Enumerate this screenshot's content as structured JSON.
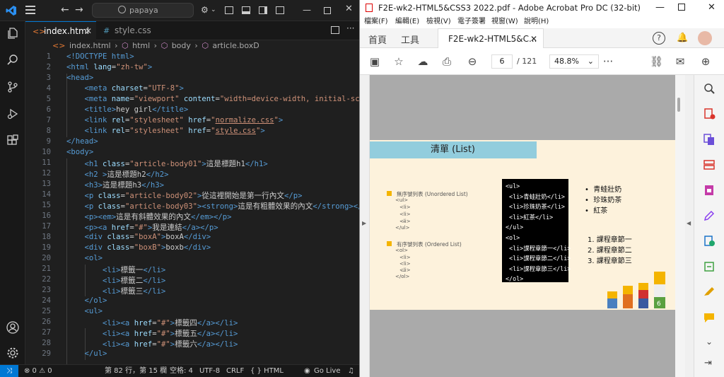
{
  "vscode": {
    "command_center": "papaya",
    "tabs": [
      {
        "label": "index.html",
        "icon": "<>"
      },
      {
        "label": "style.css",
        "icon": "#"
      }
    ],
    "breadcrumb": [
      "index.html",
      "html",
      "body",
      "article.boxD"
    ],
    "code_lines": [
      {
        "n": "1",
        "html": "<span class='t'>&lt;!DOCTYPE html&gt;</span>"
      },
      {
        "n": "2",
        "html": "<span class='t'>&lt;html</span> <span class='a'>lang</span>=<span class='s'>\"zh-tw\"</span><span class='t'>&gt;</span>"
      },
      {
        "n": "3",
        "html": "<span class='t'>&lt;head&gt;</span>"
      },
      {
        "n": "4",
        "html": "    <span class='t'>&lt;meta</span> <span class='a'>charset</span>=<span class='s'>\"UTF-8\"</span><span class='t'>&gt;</span>"
      },
      {
        "n": "5",
        "html": "    <span class='t'>&lt;meta</span> <span class='a'>name</span>=<span class='s'>\"viewport\"</span> <span class='a'>content</span>=<span class='s'>\"width=device-width, initial-scale</span>"
      },
      {
        "n": "6",
        "html": "    <span class='t'>&lt;title&gt;</span>hey girl<span class='t'>&lt;/title&gt;</span>"
      },
      {
        "n": "7",
        "html": "    <span class='t'>&lt;link</span> <span class='a'>rel</span>=<span class='s'>\"stylesheet\"</span> <span class='a'>href</span>=<span class='s'>\"<u>normalize.css</u>\"</span><span class='t'>&gt;</span>"
      },
      {
        "n": "8",
        "html": "    <span class='t'>&lt;link</span> <span class='a'>rel</span>=<span class='s'>\"stylesheet\"</span> <span class='a'>href</span>=<span class='s'>\"<u>style.css</u>\"</span><span class='t'>&gt;</span>"
      },
      {
        "n": "9",
        "html": "<span class='t'>&lt;/head&gt;</span>"
      },
      {
        "n": "10",
        "html": "<span class='t'>&lt;body&gt;</span>"
      },
      {
        "n": "11",
        "html": "    <span class='t'>&lt;h1</span> <span class='a'>class</span>=<span class='s'>\"article-body01\"</span><span class='t'>&gt;</span>這是標題h1<span class='t'>&lt;/h1&gt;</span>"
      },
      {
        "n": "12",
        "html": "    <span class='t'>&lt;h2</span> <span class='t'>&gt;</span>這是標題h2<span class='t'>&lt;/h2&gt;</span>"
      },
      {
        "n": "13",
        "html": "    <span class='t'>&lt;h3&gt;</span>這是標題h3<span class='t'>&lt;/h3&gt;</span>"
      },
      {
        "n": "14",
        "html": "    <span class='t'>&lt;p</span> <span class='a'>class</span>=<span class='s'>\"article-body02\"</span><span class='t'>&gt;</span>從這裡開始是第一行內文<span class='t'>&lt;/p&gt;</span>"
      },
      {
        "n": "15",
        "html": "    <span class='t'>&lt;p</span> <span class='a'>class</span>=<span class='s'>\"article-body03\"</span><span class='t'>&gt;&lt;strong&gt;</span>這是有粗體效果的內文<span class='t'>&lt;/strong&gt;&lt;/</span>"
      },
      {
        "n": "16",
        "html": "    <span class='t'>&lt;p&gt;&lt;em&gt;</span>這是有斜體效果的內文<span class='t'>&lt;/em&gt;&lt;/p&gt;</span>"
      },
      {
        "n": "17",
        "html": "    <span class='t'>&lt;p&gt;&lt;a</span> <span class='a'>href</span>=<span class='s'>\"#\"</span><span class='t'>&gt;</span>我是連結<span class='t'>&lt;/a&gt;&lt;/p&gt;</span>"
      },
      {
        "n": "18",
        "html": "    <span class='t'>&lt;div</span> <span class='a'>class</span>=<span class='s'>\"boxA\"</span><span class='t'>&gt;</span>boxA<span class='t'>&lt;/div&gt;</span>"
      },
      {
        "n": "19",
        "html": "    <span class='t'>&lt;div</span> <span class='a'>class</span>=<span class='s'>\"boxB\"</span><span class='t'>&gt;</span>boxb<span class='t'>&lt;/div&gt;</span>"
      },
      {
        "n": "20",
        "html": "    <span class='t'>&lt;ol&gt;</span>"
      },
      {
        "n": "21",
        "html": "        <span class='t'>&lt;li&gt;</span>標籤一<span class='t'>&lt;/li&gt;</span>"
      },
      {
        "n": "22",
        "html": "        <span class='t'>&lt;li&gt;</span>標籤二<span class='t'>&lt;/li&gt;</span>"
      },
      {
        "n": "23",
        "html": "        <span class='t'>&lt;li&gt;</span>標籤三<span class='t'>&lt;/li&gt;</span>"
      },
      {
        "n": "24",
        "html": "    <span class='t'>&lt;/ol&gt;</span>"
      },
      {
        "n": "25",
        "html": "    <span class='t'>&lt;ul&gt;</span>"
      },
      {
        "n": "26",
        "html": "        <span class='t'>&lt;li&gt;&lt;a</span> <span class='a'>href</span>=<span class='s'>\"#\"</span><span class='t'>&gt;</span>標籤四<span class='t'>&lt;/a&gt;&lt;/li&gt;</span>"
      },
      {
        "n": "27",
        "html": "        <span class='t'>&lt;li&gt;&lt;a</span> <span class='a'>href</span>=<span class='s'>\"#\"</span><span class='t'>&gt;</span>標籤五<span class='t'>&lt;/a&gt;&lt;/li&gt;</span>"
      },
      {
        "n": "28",
        "html": "        <span class='t'>&lt;li&gt;&lt;a</span> <span class='a'>href</span>=<span class='s'>\"#\"</span><span class='t'>&gt;</span>標籤六<span class='t'>&lt;/a&gt;&lt;/li&gt;</span>"
      },
      {
        "n": "29",
        "html": "    <span class='t'>&lt;/ul&gt;</span>"
      }
    ],
    "status": {
      "problems": "⊗ 0 ⚠ 0",
      "position": "第 82 行，第 15 欄",
      "spaces": "空格: 4",
      "encoding": "UTF-8",
      "eol": "CRLF",
      "language": "{ } HTML",
      "golive": "Go Live"
    }
  },
  "acrobat": {
    "title": "F2E-wk2-HTML5&CSS3 2022.pdf - Adobe Acrobat Pro DC (32-bit)",
    "menu": [
      "檔案(F)",
      "編輯(E)",
      "檢視(V)",
      "電子簽署",
      "視窗(W)",
      "說明(H)"
    ],
    "tabs": {
      "home": "首頁",
      "tools": "工具",
      "doc": "F2E-wk2-HTML5&C..."
    },
    "page_current": "6",
    "page_total": "/ 121",
    "zoom": "48.8%",
    "slide": {
      "title": "清單 (List)",
      "left_items": [
        {
          "label": "無序號列表 (Unordered List)",
          "lines": [
            "<ul>",
            "<li>",
            "<li>",
            "<li>",
            "...",
            "</ul>"
          ]
        },
        {
          "label": "有序號列表 (Ordered List)",
          "lines": [
            "<ol>",
            "<li>",
            "<li>",
            "<li>",
            "...",
            "</ol>"
          ]
        }
      ],
      "code_block": [
        "<ul>",
        " <li>青蛙壯奶</li>",
        " <li>珍珠奶茶</li>",
        " <li>紅茶</li>",
        "</ul>",
        "<ol>",
        " <li>課程章節一</li>",
        " <li>課程章節二</li>",
        " <li>課程章節三</li>",
        "</ol>"
      ],
      "bullets": [
        "青蛙壯奶",
        "珍珠奶茶",
        "紅茶"
      ],
      "ordered": [
        "1.  課程章節一",
        "2.  課程章節二",
        "3.  課程章節三"
      ],
      "lego_number": "6"
    }
  }
}
